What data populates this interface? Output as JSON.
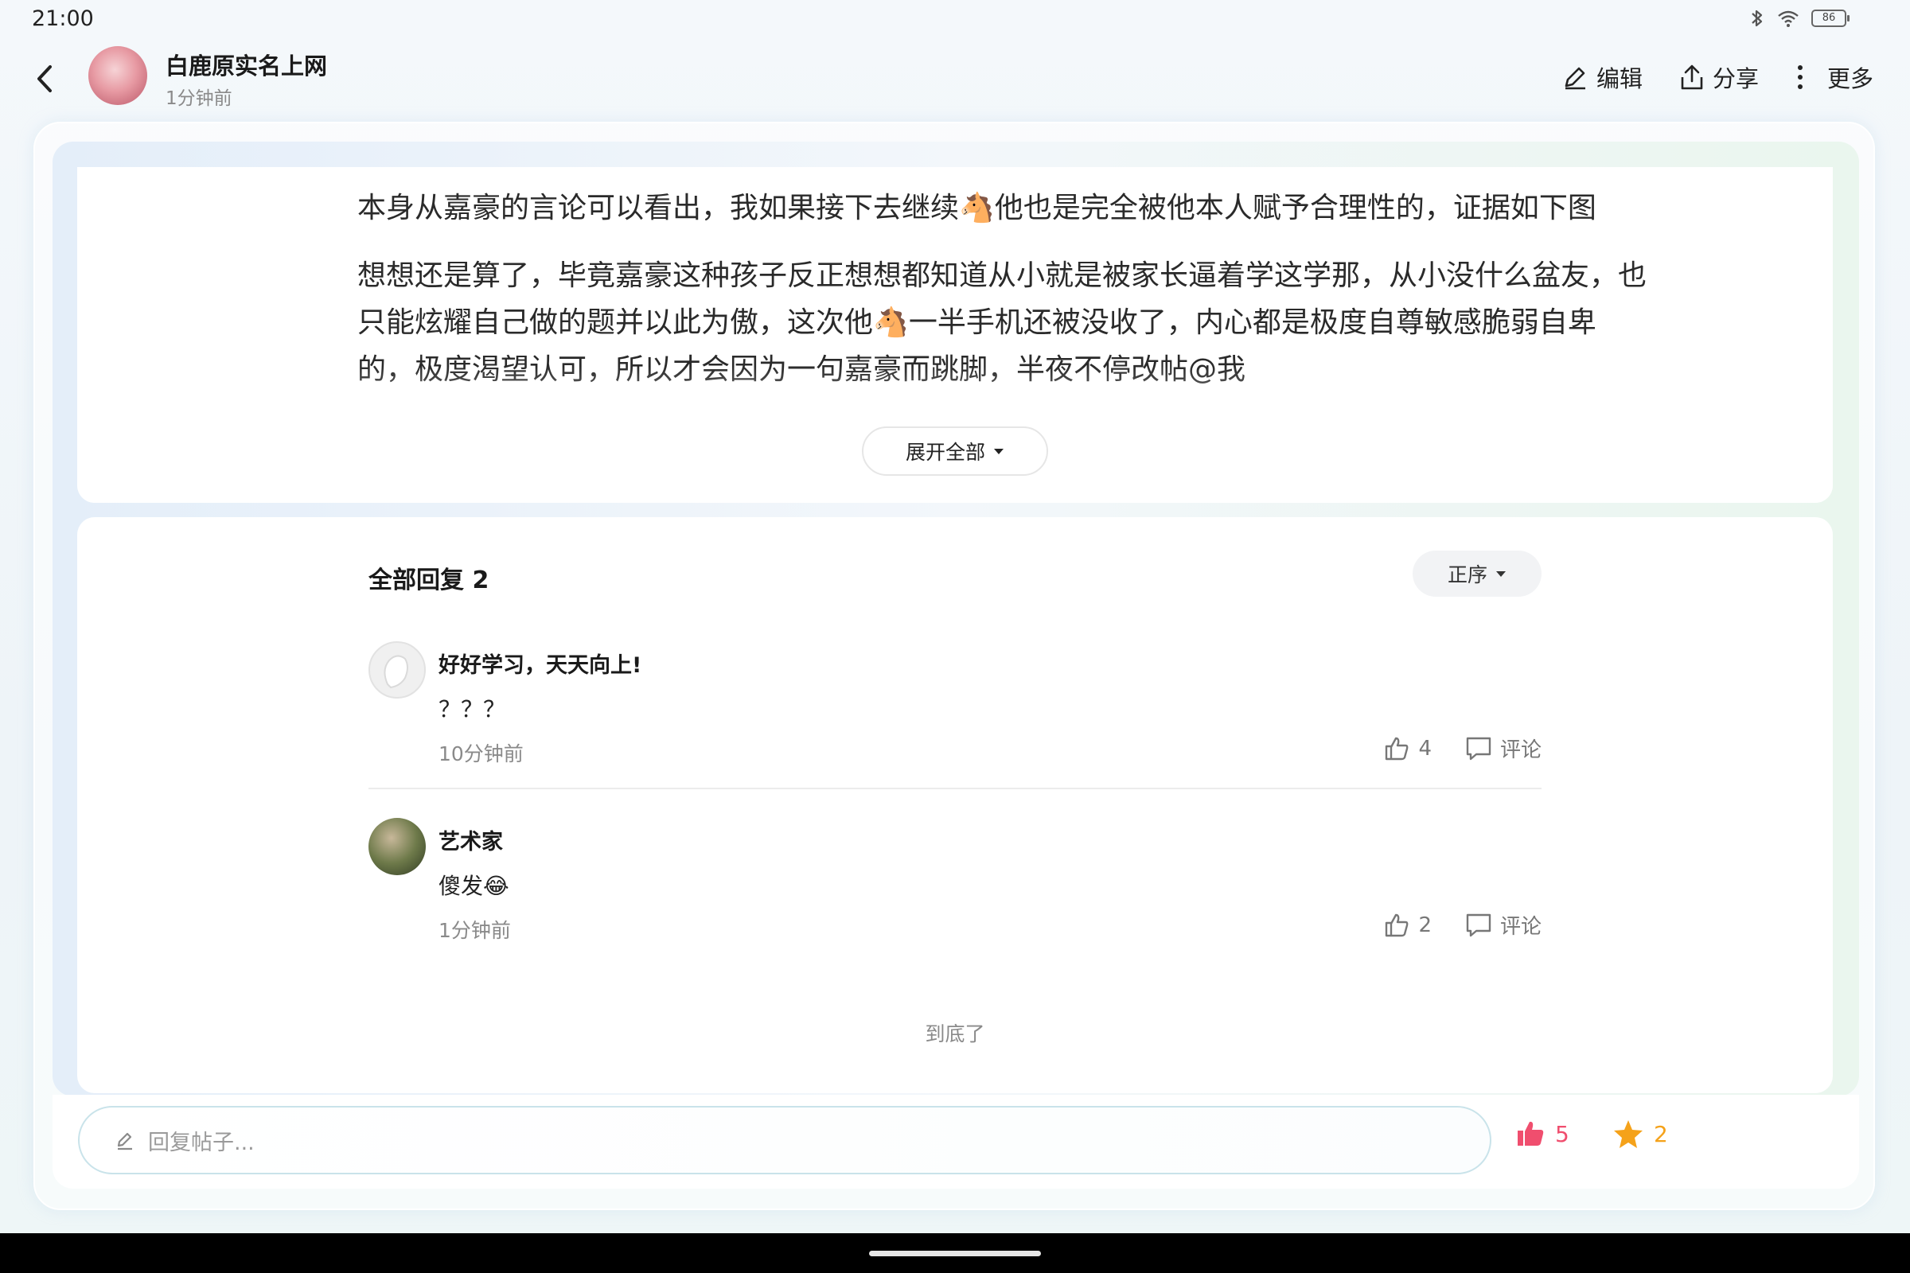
{
  "status_bar": {
    "time": "21:00",
    "battery": "86"
  },
  "header": {
    "author": "白鹿原实名上网",
    "time": "1分钟前",
    "actions": {
      "edit": "编辑",
      "share": "分享",
      "more": "更多"
    }
  },
  "post": {
    "paragraphs": [
      "本身从嘉豪的言论可以看出，我如果接下去继续🐴他也是完全被他本人赋予合理性的，证据如下图",
      "想想还是算了，毕竟嘉豪这种孩子反正想想都知道从小就是被家长逼着学这学那，从小没什么盆友，也只能炫耀自己做的题并以此为傲，这次他🐴一半手机还被没收了，内心都是极度自尊敏感脆弱自卑的，极度渴望认可，所以才会因为一句嘉豪而跳脚，半夜不停改帖@我"
    ],
    "expand_label": "展开全部"
  },
  "replies": {
    "title": "全部回复 2",
    "sort_label": "正序",
    "items": [
      {
        "user": "好好学习，天天向上!",
        "text": "？？？",
        "time": "10分钟前",
        "likes": "4",
        "comment_label": "评论"
      },
      {
        "user": "艺术家",
        "text": "傻发😂",
        "time": "1分钟前",
        "likes": "2",
        "comment_label": "评论"
      }
    ],
    "end_note": "到底了"
  },
  "reply_bar": {
    "placeholder": "回复帖子...",
    "likes": "5",
    "favorites": "2"
  },
  "colors": {
    "like": "#f04e6e",
    "favorite": "#f5a21a",
    "input_border": "#c9e3ea"
  }
}
